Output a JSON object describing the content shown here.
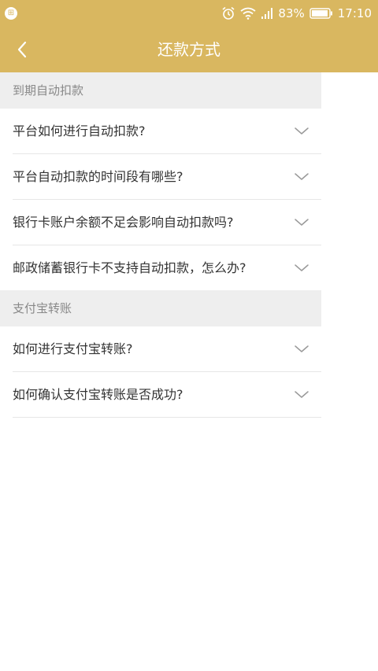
{
  "status_bar": {
    "battery_percent": "83%",
    "time": "17:10",
    "icons": [
      "app-notification-icon",
      "alarm-icon",
      "wifi-icon",
      "signal-icon",
      "battery-icon"
    ]
  },
  "header": {
    "title": "还款方式",
    "back_icon": "chevron-left-icon"
  },
  "sections": [
    {
      "title": "到期自动扣款",
      "items": [
        "平台如何进行自动扣款?",
        "平台自动扣款的时间段有哪些?",
        "银行卡账户余额不足会影响自动扣款吗?",
        "邮政储蓄银行卡不支持自动扣款，怎么办?"
      ]
    },
    {
      "title": "支付宝转账",
      "items": [
        "如何进行支付宝转账?",
        "如何确认支付宝转账是否成功?"
      ]
    }
  ],
  "colors": {
    "accent": "#d9b760",
    "section_bg": "#eeeeee",
    "text": "#333333",
    "muted": "#888888"
  }
}
